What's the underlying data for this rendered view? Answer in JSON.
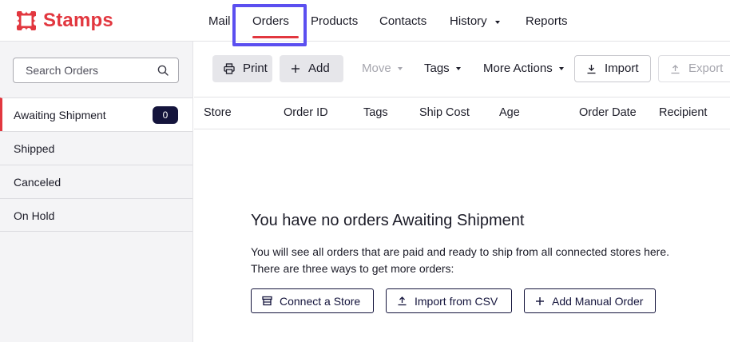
{
  "brand": {
    "name": "Stamps",
    "color": "#e2373f",
    "logo_icon": "stamp-frame-icon"
  },
  "nav": {
    "items": [
      {
        "label": "Mail"
      },
      {
        "label": "Orders",
        "active": true
      },
      {
        "label": "Products"
      },
      {
        "label": "Contacts"
      },
      {
        "label": "History",
        "has_dropdown": true
      },
      {
        "label": "Reports"
      }
    ]
  },
  "sidebar": {
    "search": {
      "placeholder": "Search Orders",
      "value": "",
      "icon": "search-icon"
    },
    "items": [
      {
        "label": "Awaiting Shipment",
        "badge": "0",
        "active": true
      },
      {
        "label": "Shipped"
      },
      {
        "label": "Canceled"
      },
      {
        "label": "On Hold"
      }
    ]
  },
  "toolbar": {
    "print": {
      "label": "Print",
      "icon": "printer-icon"
    },
    "add": {
      "label": "Add",
      "icon": "plus-icon"
    },
    "move": {
      "label": "Move",
      "disabled": true
    },
    "tags": {
      "label": "Tags"
    },
    "more_actions": {
      "label": "More Actions"
    },
    "import": {
      "label": "Import",
      "icon": "download-icon"
    },
    "export": {
      "label": "Export",
      "icon": "upload-icon",
      "disabled": true
    }
  },
  "table": {
    "columns": [
      "Store",
      "Order ID",
      "Tags",
      "Ship Cost",
      "Age",
      "Order Date",
      "Recipient"
    ]
  },
  "empty_state": {
    "title": "You have no orders Awaiting Shipment",
    "line1": "You will see all orders that are paid and ready to ship from all connected stores here.",
    "line2": "There are three ways to get more orders:",
    "actions": [
      {
        "label": "Connect a Store",
        "icon": "store-icon"
      },
      {
        "label": "Import from CSV",
        "icon": "upload-icon"
      },
      {
        "label": "Add Manual Order",
        "icon": "plus-icon"
      }
    ]
  },
  "colors": {
    "accent": "#e2373f",
    "highlight_box": "#5b4ff0",
    "navy": "#14143c"
  }
}
